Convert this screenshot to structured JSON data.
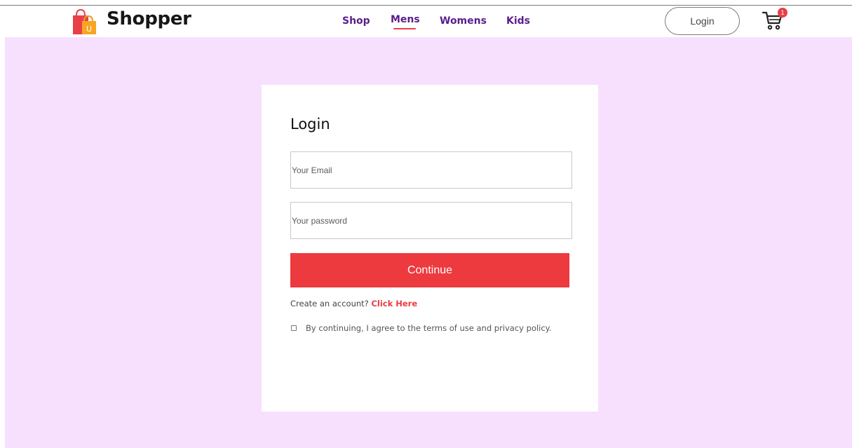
{
  "brand": {
    "name": "Shopper"
  },
  "nav": {
    "items": [
      {
        "label": "Shop"
      },
      {
        "label": "Mens",
        "active": true
      },
      {
        "label": "Womens"
      },
      {
        "label": "Kids"
      }
    ]
  },
  "header": {
    "login_label": "Login",
    "cart_count": "1",
    "cart_icon": "shopping-cart-icon"
  },
  "form": {
    "title": "Login",
    "email_placeholder": "Your Email",
    "password_placeholder": "Your password",
    "submit_label": "Continue",
    "signup_prompt": "Create an account?",
    "signup_link": "Click Here",
    "agree_text": "By continuing, I agree to the terms of use and privacy policy."
  },
  "colors": {
    "accent": "#ec3a3f",
    "nav_text": "#5a1e8c",
    "background": "#f7e0fd"
  }
}
